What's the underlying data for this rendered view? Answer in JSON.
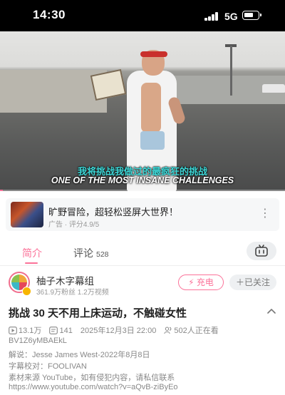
{
  "status_bar": {
    "time": "14:30",
    "network": "5G",
    "battery_level": 0.75
  },
  "player": {
    "subtitle_cn": "我将挑战我做过的最疯狂的挑战",
    "subtitle_en": "ONE OF THE MOST INSANE CHALLENGES",
    "progress_fraction": 0.01
  },
  "ad": {
    "title": "旷野冒险，超轻松竖屏大世界！",
    "subtitle": "广告 · 评分4.9/5"
  },
  "tabs": {
    "intro": "简介",
    "comments": "评论",
    "comments_count": "528"
  },
  "uploader": {
    "name": "柚子木字幕组",
    "stats": "361.9万粉丝  1.2万视频",
    "charge_label": "充电",
    "follow_label": "已关注"
  },
  "video": {
    "title": "挑战 30 天不用上床运动，不触碰女性",
    "views": "13.1万",
    "danmaku": "141",
    "date": "2025年12月3日 22:00",
    "watching": "502人正在看",
    "bvid": "BV1Z6yMBAEkL",
    "desc_lines": [
      "解说：Jesse James West-2022年8月8日",
      "字幕校对：FOOLIVAN",
      "素材来源 YouTube，如有侵犯内容，请私信联系",
      "https://www.youtube.com/watch?v=aQvB-ziByEo"
    ]
  },
  "colors": {
    "accent": "#fb7299"
  },
  "icons": [
    "signal-icon",
    "battery-icon",
    "more-icon",
    "tv-icon",
    "charge-icon",
    "plus-icon",
    "collapse-chevron-icon",
    "play-count-icon",
    "danmaku-icon",
    "watching-icon"
  ]
}
